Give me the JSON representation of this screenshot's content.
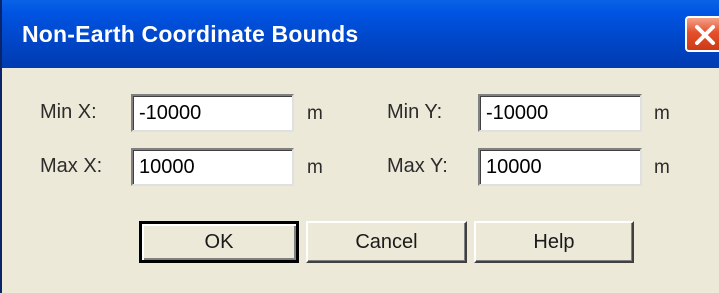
{
  "window": {
    "title": "Non-Earth Coordinate Bounds",
    "close_icon": "close-x-icon"
  },
  "fields": {
    "min_x": {
      "label": "Min X:",
      "value": "-10000",
      "unit": "m"
    },
    "max_x": {
      "label": "Max X:",
      "value": "10000",
      "unit": "m"
    },
    "min_y": {
      "label": "Min Y:",
      "value": "-10000",
      "unit": "m"
    },
    "max_y": {
      "label": "Max Y:",
      "value": "10000",
      "unit": "m"
    }
  },
  "buttons": {
    "ok": "OK",
    "cancel": "Cancel",
    "help": "Help"
  },
  "colors": {
    "titlebar": "#0054e3",
    "dialog_face": "#ece9d8",
    "close_button": "#e5502c"
  }
}
